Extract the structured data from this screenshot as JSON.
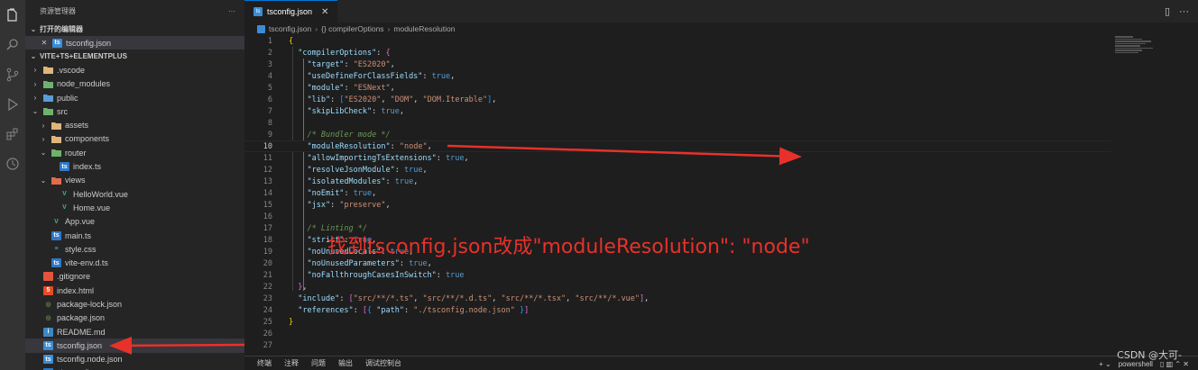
{
  "sidebar": {
    "title": "资源管理器",
    "more": "···",
    "open_editors_label": "打开的编辑器",
    "open_editor_item": "tsconfig.json",
    "project_label": "VITE+TS+ELEMENTPLUS",
    "items": [
      {
        "label": ".vscode",
        "twisty": "›",
        "icon": "folder",
        "indent": 1
      },
      {
        "label": "node_modules",
        "twisty": "›",
        "icon": "folder-green",
        "indent": 1
      },
      {
        "label": "public",
        "twisty": "›",
        "icon": "folder-blue",
        "indent": 1
      },
      {
        "label": "src",
        "twisty": "⌄",
        "icon": "folder-green",
        "indent": 1
      },
      {
        "label": "assets",
        "twisty": "›",
        "icon": "folder",
        "indent": 2
      },
      {
        "label": "components",
        "twisty": "›",
        "icon": "folder",
        "indent": 2
      },
      {
        "label": "router",
        "twisty": "⌄",
        "icon": "folder-green",
        "indent": 2
      },
      {
        "label": "index.ts",
        "twisty": "",
        "icon": "ts",
        "indent": 3
      },
      {
        "label": "views",
        "twisty": "⌄",
        "icon": "folder-red",
        "indent": 2
      },
      {
        "label": "HelloWorld.vue",
        "twisty": "",
        "icon": "vue",
        "indent": 3
      },
      {
        "label": "Home.vue",
        "twisty": "",
        "icon": "vue",
        "indent": 3
      },
      {
        "label": "App.vue",
        "twisty": "",
        "icon": "vue",
        "indent": 2
      },
      {
        "label": "main.ts",
        "twisty": "",
        "icon": "ts",
        "indent": 2
      },
      {
        "label": "style.css",
        "twisty": "",
        "icon": "css",
        "indent": 2
      },
      {
        "label": "vite-env.d.ts",
        "twisty": "",
        "icon": "ts",
        "indent": 2
      },
      {
        "label": ".gitignore",
        "twisty": "",
        "icon": "git",
        "indent": 1
      },
      {
        "label": "index.html",
        "twisty": "",
        "icon": "html",
        "indent": 1
      },
      {
        "label": "package-lock.json",
        "twisty": "",
        "icon": "npm",
        "indent": 1
      },
      {
        "label": "package.json",
        "twisty": "",
        "icon": "npm",
        "indent": 1
      },
      {
        "label": "README.md",
        "twisty": "",
        "icon": "info",
        "indent": 1
      },
      {
        "label": "tsconfig.json",
        "twisty": "",
        "icon": "tsconfig",
        "indent": 1,
        "selected": true
      },
      {
        "label": "tsconfig.node.json",
        "twisty": "",
        "icon": "tsconfig",
        "indent": 1
      },
      {
        "label": "vite.config.ts",
        "twisty": "",
        "icon": "ts",
        "indent": 1
      }
    ]
  },
  "editor": {
    "tab_label": "tsconfig.json",
    "breadcrumb": [
      "tsconfig.json",
      "{} compilerOptions",
      "moduleResolution"
    ],
    "current_line": 10,
    "lines": [
      [
        [
          "b1",
          "{"
        ]
      ],
      [
        [
          "p",
          "  "
        ],
        [
          "k",
          "\"compilerOptions\""
        ],
        [
          "p",
          ": "
        ],
        [
          "b2",
          "{"
        ]
      ],
      [
        [
          "p",
          "    "
        ],
        [
          "k",
          "\"target\""
        ],
        [
          "p",
          ": "
        ],
        [
          "s",
          "\"ES2020\""
        ],
        [
          "p",
          ","
        ]
      ],
      [
        [
          "p",
          "    "
        ],
        [
          "k",
          "\"useDefineForClassFields\""
        ],
        [
          "p",
          ": "
        ],
        [
          "kw",
          "true"
        ],
        [
          "p",
          ","
        ]
      ],
      [
        [
          "p",
          "    "
        ],
        [
          "k",
          "\"module\""
        ],
        [
          "p",
          ": "
        ],
        [
          "s",
          "\"ESNext\""
        ],
        [
          "p",
          ","
        ]
      ],
      [
        [
          "p",
          "    "
        ],
        [
          "k",
          "\"lib\""
        ],
        [
          "p",
          ": "
        ],
        [
          "b3",
          "["
        ],
        [
          "s",
          "\"ES2020\""
        ],
        [
          "p",
          ", "
        ],
        [
          "s",
          "\"DOM\""
        ],
        [
          "p",
          ", "
        ],
        [
          "s",
          "\"DOM.Iterable\""
        ],
        [
          "b3",
          "]"
        ],
        [
          "p",
          ","
        ]
      ],
      [
        [
          "p",
          "    "
        ],
        [
          "k",
          "\"skipLibCheck\""
        ],
        [
          "p",
          ": "
        ],
        [
          "kw",
          "true"
        ],
        [
          "p",
          ","
        ]
      ],
      [
        [
          "p",
          ""
        ]
      ],
      [
        [
          "p",
          "    "
        ],
        [
          "c",
          "/* Bundler mode */"
        ]
      ],
      [
        [
          "p",
          "    "
        ],
        [
          "k",
          "\"moduleResolution\""
        ],
        [
          "p",
          ": "
        ],
        [
          "s",
          "\"node\""
        ],
        [
          "p",
          ","
        ]
      ],
      [
        [
          "p",
          "    "
        ],
        [
          "k",
          "\"allowImportingTsExtensions\""
        ],
        [
          "p",
          ": "
        ],
        [
          "kw",
          "true"
        ],
        [
          "p",
          ","
        ]
      ],
      [
        [
          "p",
          "    "
        ],
        [
          "k",
          "\"resolveJsonModule\""
        ],
        [
          "p",
          ": "
        ],
        [
          "kw",
          "true"
        ],
        [
          "p",
          ","
        ]
      ],
      [
        [
          "p",
          "    "
        ],
        [
          "k",
          "\"isolatedModules\""
        ],
        [
          "p",
          ": "
        ],
        [
          "kw",
          "true"
        ],
        [
          "p",
          ","
        ]
      ],
      [
        [
          "p",
          "    "
        ],
        [
          "k",
          "\"noEmit\""
        ],
        [
          "p",
          ": "
        ],
        [
          "kw",
          "true"
        ],
        [
          "p",
          ","
        ]
      ],
      [
        [
          "p",
          "    "
        ],
        [
          "k",
          "\"jsx\""
        ],
        [
          "p",
          ": "
        ],
        [
          "s",
          "\"preserve\""
        ],
        [
          "p",
          ","
        ]
      ],
      [
        [
          "p",
          ""
        ]
      ],
      [
        [
          "p",
          "    "
        ],
        [
          "c",
          "/* Linting */"
        ]
      ],
      [
        [
          "p",
          "    "
        ],
        [
          "k",
          "\"strict\""
        ],
        [
          "p",
          ": "
        ],
        [
          "kw",
          "true"
        ],
        [
          "p",
          ","
        ]
      ],
      [
        [
          "p",
          "    "
        ],
        [
          "k",
          "\"noUnusedLocals\""
        ],
        [
          "p",
          ": "
        ],
        [
          "kw",
          "true"
        ],
        [
          "p",
          ","
        ]
      ],
      [
        [
          "p",
          "    "
        ],
        [
          "k",
          "\"noUnusedParameters\""
        ],
        [
          "p",
          ": "
        ],
        [
          "kw",
          "true"
        ],
        [
          "p",
          ","
        ]
      ],
      [
        [
          "p",
          "    "
        ],
        [
          "k",
          "\"noFallthroughCasesInSwitch\""
        ],
        [
          "p",
          ": "
        ],
        [
          "kw",
          "true"
        ]
      ],
      [
        [
          "p",
          "  "
        ],
        [
          "b2",
          "}"
        ],
        [
          "p",
          ","
        ]
      ],
      [
        [
          "p",
          "  "
        ],
        [
          "k",
          "\"include\""
        ],
        [
          "p",
          ": "
        ],
        [
          "b2",
          "["
        ],
        [
          "s",
          "\"src/**/*.ts\""
        ],
        [
          "p",
          ", "
        ],
        [
          "s",
          "\"src/**/*.d.ts\""
        ],
        [
          "p",
          ", "
        ],
        [
          "s",
          "\"src/**/*.tsx\""
        ],
        [
          "p",
          ", "
        ],
        [
          "s",
          "\"src/**/*.vue\""
        ],
        [
          "b2",
          "]"
        ],
        [
          "p",
          ","
        ]
      ],
      [
        [
          "p",
          "  "
        ],
        [
          "k",
          "\"references\""
        ],
        [
          "p",
          ": "
        ],
        [
          "b2",
          "["
        ],
        [
          "b3",
          "{"
        ],
        [
          "p",
          " "
        ],
        [
          "k",
          "\"path\""
        ],
        [
          "p",
          ": "
        ],
        [
          "s",
          "\"./tsconfig.node.json\""
        ],
        [
          "p",
          " "
        ],
        [
          "b3",
          "}"
        ],
        [
          "b2",
          "]"
        ]
      ],
      [
        [
          "b1",
          "}"
        ]
      ],
      [
        [
          "p",
          ""
        ]
      ],
      [
        [
          "p",
          ""
        ]
      ]
    ]
  },
  "annotation": "找到tsconfig.json改成\"moduleResolution\": \"node\"",
  "panel": {
    "tabs": [
      "终端",
      "注释",
      "问题",
      "输出",
      "调试控制台"
    ],
    "shell": "powershell",
    "actions": "+ ⌄   ▯  🗑  ⌃  ✕"
  },
  "watermark": "CSDN @大可-",
  "colors": {
    "accent": "#0078d4",
    "annotation_red": "#e8312a"
  }
}
